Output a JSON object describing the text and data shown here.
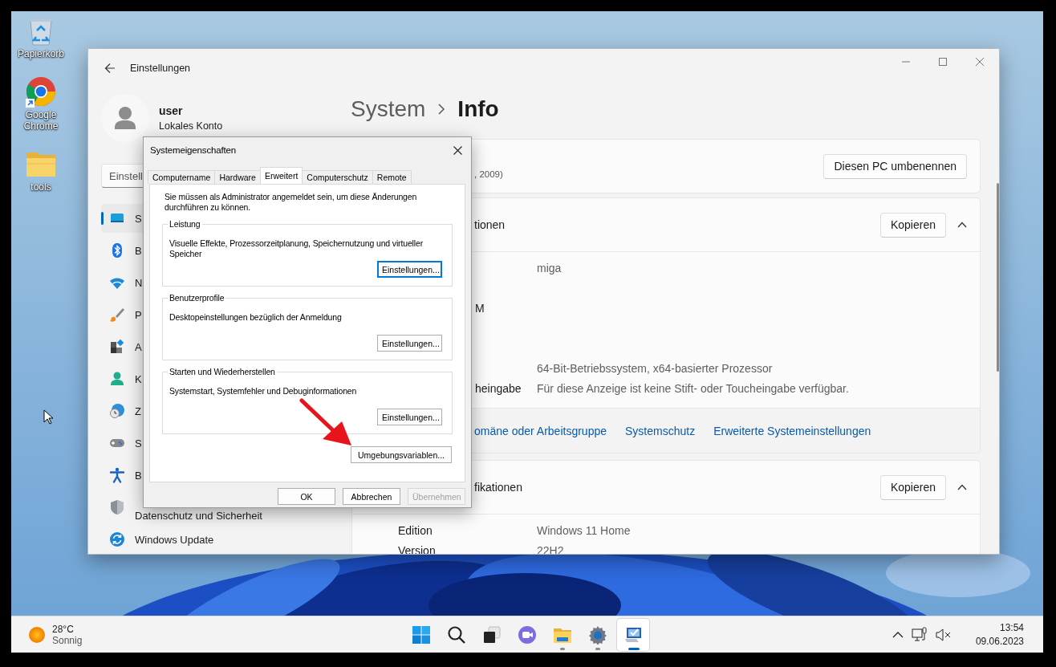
{
  "desktop": {
    "icons": [
      {
        "label": "Papierkorb",
        "kind": "bin"
      },
      {
        "label": "Google Chrome",
        "kind": "browser"
      },
      {
        "label": "tools",
        "kind": "folder"
      }
    ]
  },
  "settings_window": {
    "title": "Einstellungen",
    "user": {
      "name": "user",
      "account": "Lokales Konto"
    },
    "search": {
      "value": "Einstell"
    },
    "breadcrumb": {
      "parent": "System",
      "current": "Info"
    },
    "sidebar": {
      "items": [
        {
          "label": "S",
          "kind": "system",
          "selected": true
        },
        {
          "label": "B",
          "kind": "bluetooth",
          "selected": false
        },
        {
          "label": "N",
          "kind": "network",
          "selected": false
        },
        {
          "label": "P",
          "kind": "personalization",
          "selected": false
        },
        {
          "label": "A",
          "kind": "apps",
          "selected": false
        },
        {
          "label": "K",
          "kind": "accounts",
          "selected": false
        },
        {
          "label": "Z",
          "kind": "time",
          "selected": false
        },
        {
          "label": "S",
          "kind": "gaming",
          "selected": false
        },
        {
          "label": "B",
          "kind": "accessibility",
          "selected": false
        },
        {
          "label": "Datenschutz und Sicherheit",
          "kind": "privacy",
          "selected": false
        },
        {
          "label": "Windows Update",
          "kind": "update",
          "selected": false
        }
      ]
    },
    "cards": [
      {
        "subtitle": ", 2009)",
        "button": "Diesen PC umbenennen"
      },
      {
        "title": "tionen",
        "button": "Kopieren",
        "expanded": true,
        "rows": [
          {
            "value": "miga"
          },
          {
            "label": "M"
          },
          {
            "value": "64-Bit-Betriebssystem, x64-basierter Prozessor"
          },
          {
            "label": "heingabe",
            "value": "Für diese Anzeige ist keine Stift- oder Toucheingabe verfügbar."
          }
        ],
        "links": [
          "omäne oder Arbeitsgruppe",
          "Systemschutz",
          "Erweiterte Systemeinstellungen"
        ]
      },
      {
        "title": "fikationen",
        "button": "Kopieren",
        "expanded": true,
        "rows": [
          {
            "label": "Edition",
            "value": "Windows 11 Home"
          },
          {
            "label": "Version",
            "value": "22H2"
          }
        ]
      }
    ]
  },
  "dialog": {
    "title": "Systemeigenschaften",
    "tabs": [
      {
        "label": "Computername",
        "selected": false
      },
      {
        "label": "Hardware",
        "selected": false
      },
      {
        "label": "Erweitert",
        "selected": true
      },
      {
        "label": "Computerschutz",
        "selected": false
      },
      {
        "label": "Remote",
        "selected": false
      }
    ],
    "notice": "Sie müssen als Administrator angemeldet sein, um diese Änderungen durchführen zu können.",
    "groups": [
      {
        "title": "Leistung",
        "text": "Visuelle Effekte, Prozessorzeitplanung, Speichernutzung und virtueller Speicher",
        "button": "Einstellungen...",
        "focused": true
      },
      {
        "title": "Benutzerprofile",
        "text": "Desktopeinstellungen bezüglich der Anmeldung",
        "button": "Einstellungen...",
        "focused": false
      },
      {
        "title": "Starten und Wiederherstellen",
        "text": "Systemstart, Systemfehler und Debuginformationen",
        "button": "Einstellungen...",
        "focused": false
      }
    ],
    "env_button": "Umgebungsvariablen...",
    "buttons": [
      {
        "label": "OK",
        "disabled": false
      },
      {
        "label": "Abbrechen",
        "disabled": false
      },
      {
        "label": "Übernehmen",
        "disabled": true
      }
    ]
  },
  "taskbar": {
    "weather": {
      "temperature": "28°C",
      "condition": "Sonnig"
    },
    "apps": [
      {
        "kind": "start",
        "running": false,
        "active": false
      },
      {
        "kind": "search",
        "running": false,
        "active": false
      },
      {
        "kind": "taskview",
        "running": false,
        "active": false
      },
      {
        "kind": "chat",
        "running": false,
        "active": false
      },
      {
        "kind": "explorer",
        "running": true,
        "active": false
      },
      {
        "kind": "settings",
        "running": true,
        "active": false
      },
      {
        "kind": "sysprops",
        "running": true,
        "active": true
      }
    ],
    "clock": {
      "time": "13:54",
      "date": "09.06.2023"
    }
  }
}
